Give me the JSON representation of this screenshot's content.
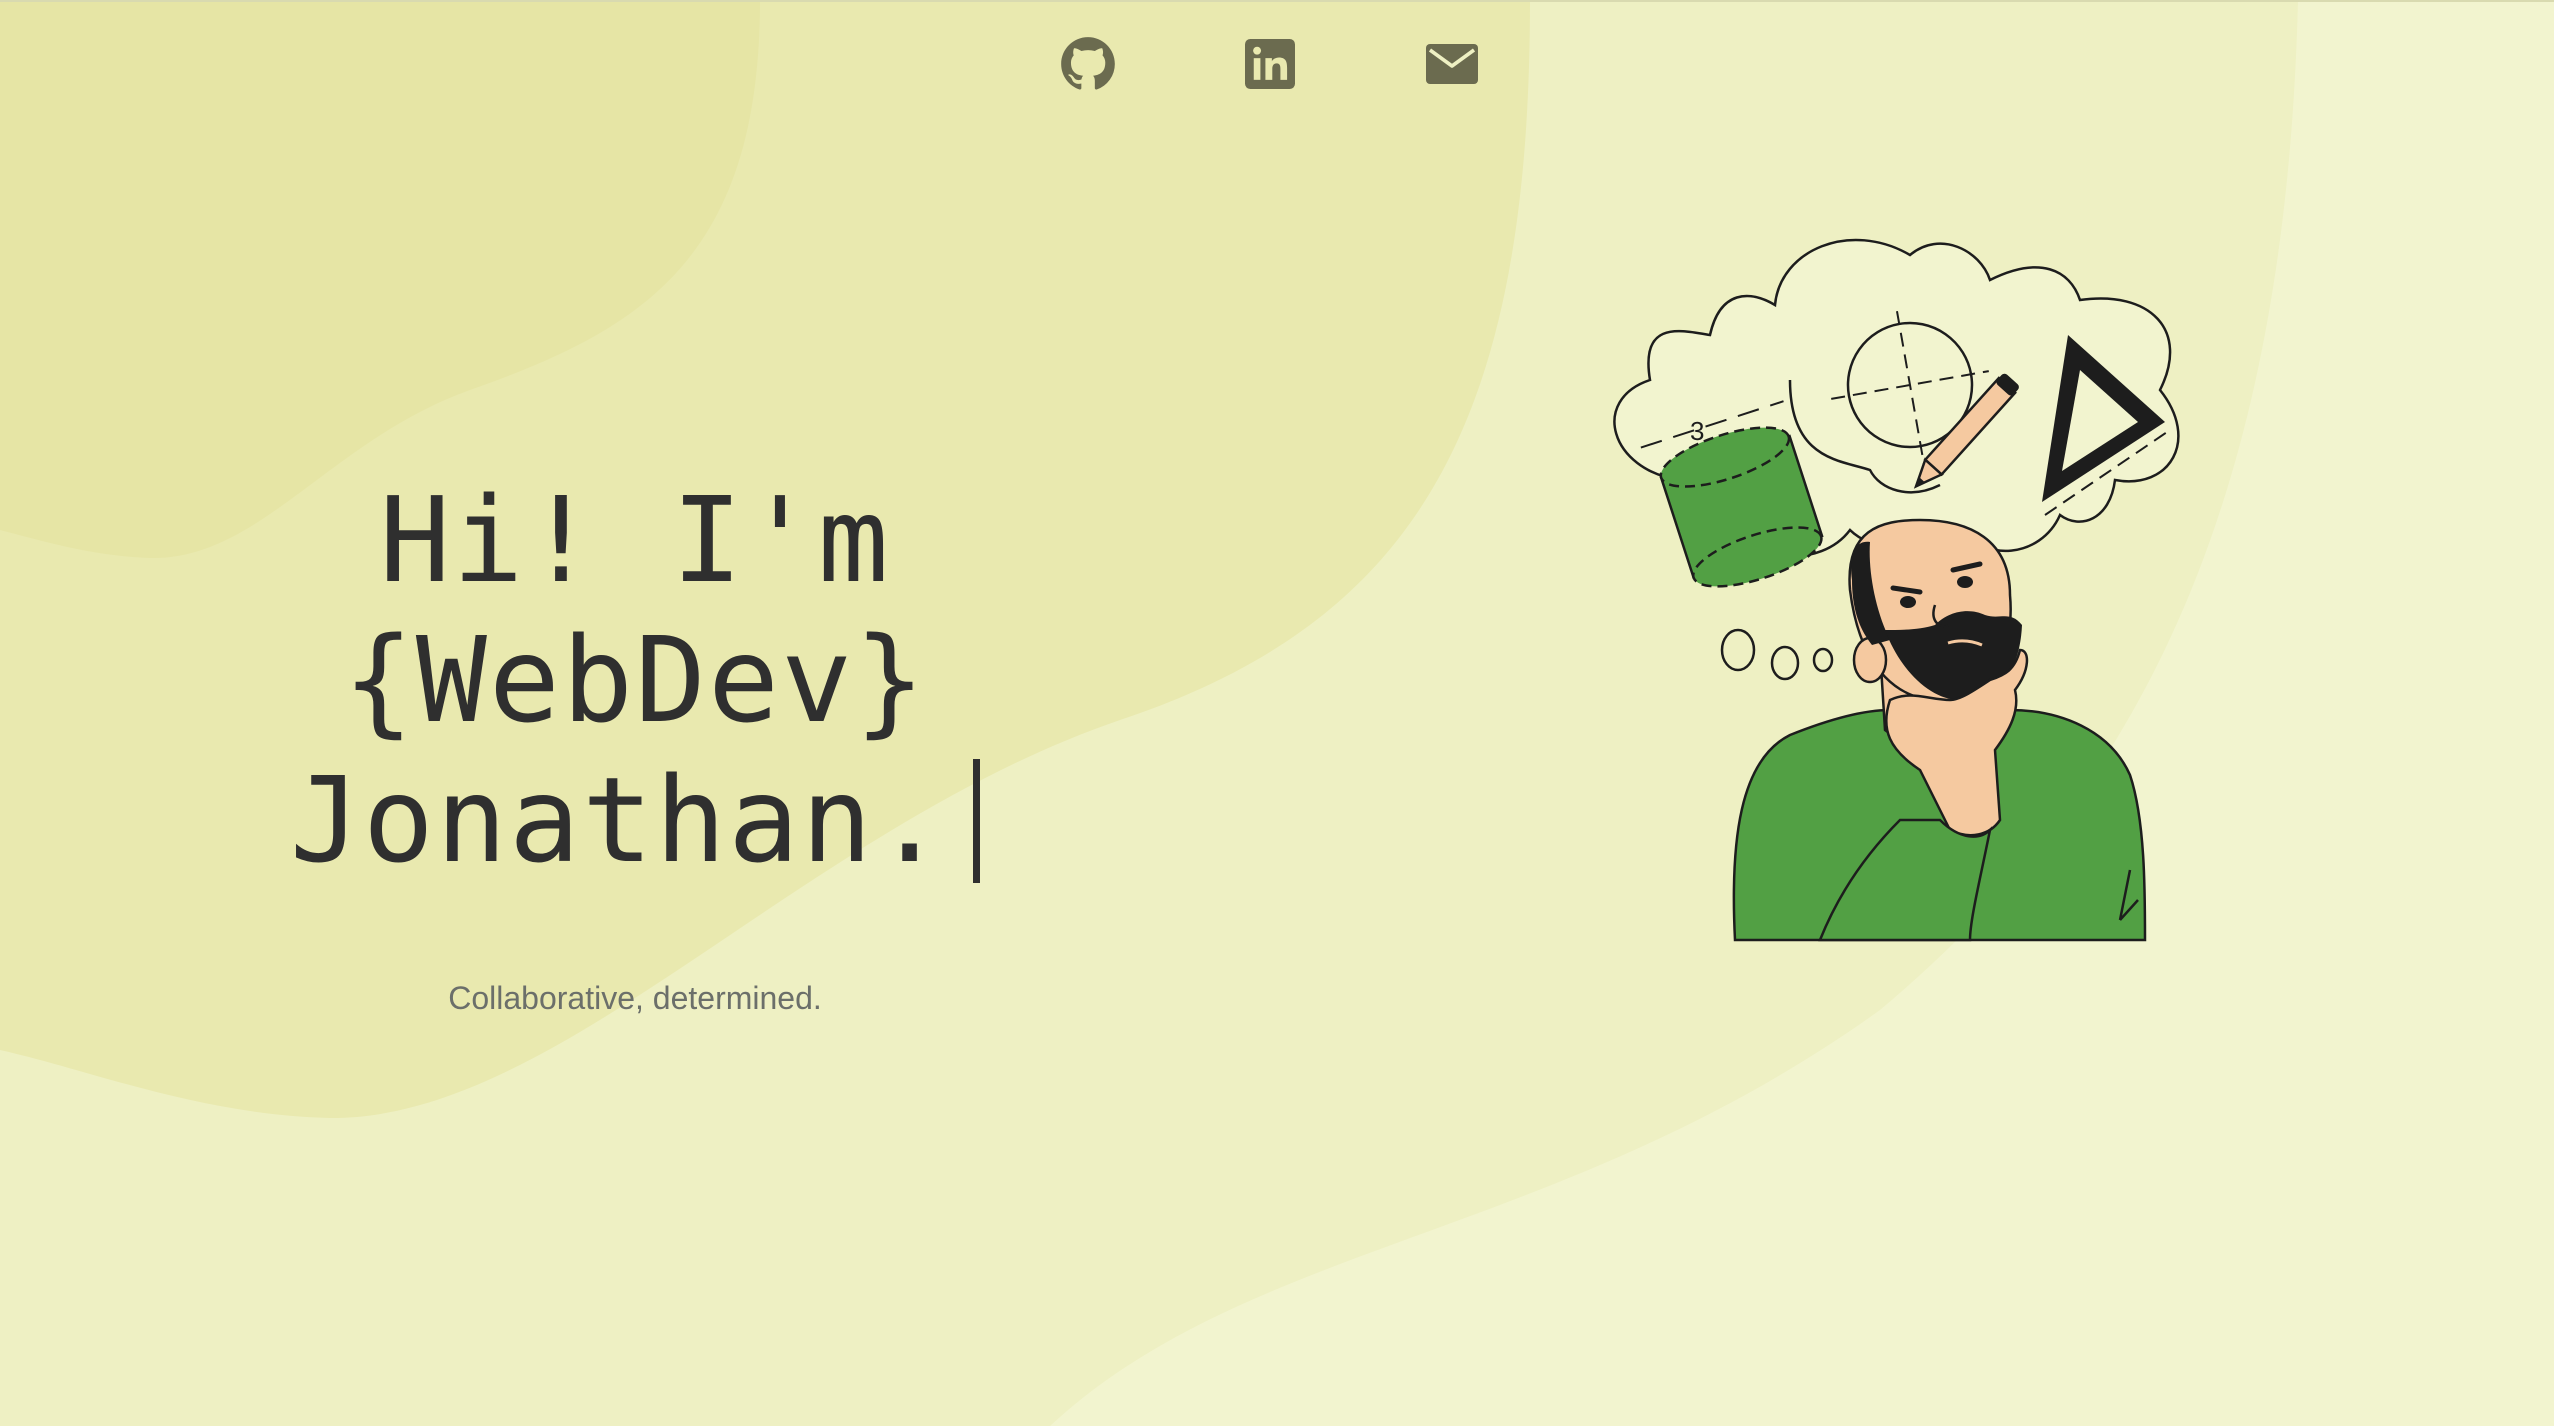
{
  "nav": {
    "links": [
      {
        "label": "GitHub",
        "icon": "github-icon"
      },
      {
        "label": "LinkedIn",
        "icon": "linkedin-icon"
      },
      {
        "label": "Email",
        "icon": "mail-icon"
      }
    ]
  },
  "hero": {
    "line1": "Hi! I'm",
    "line2": "{WebDev}",
    "line3": "Jonathan.",
    "tagline": "Collaborative, determined."
  },
  "illustration": {
    "label": "thinking-developer-illustration",
    "dimension_label": "3"
  },
  "colors": {
    "background": "#f2f4cf",
    "wave_light": "#eef0c3",
    "wave_dark": "#e8e6a6",
    "icon": "#6b6b4f",
    "text": "#2f2f2f",
    "tagline": "#6b6f6a",
    "accent_green": "#52a044",
    "skin": "#f5c9a0"
  }
}
